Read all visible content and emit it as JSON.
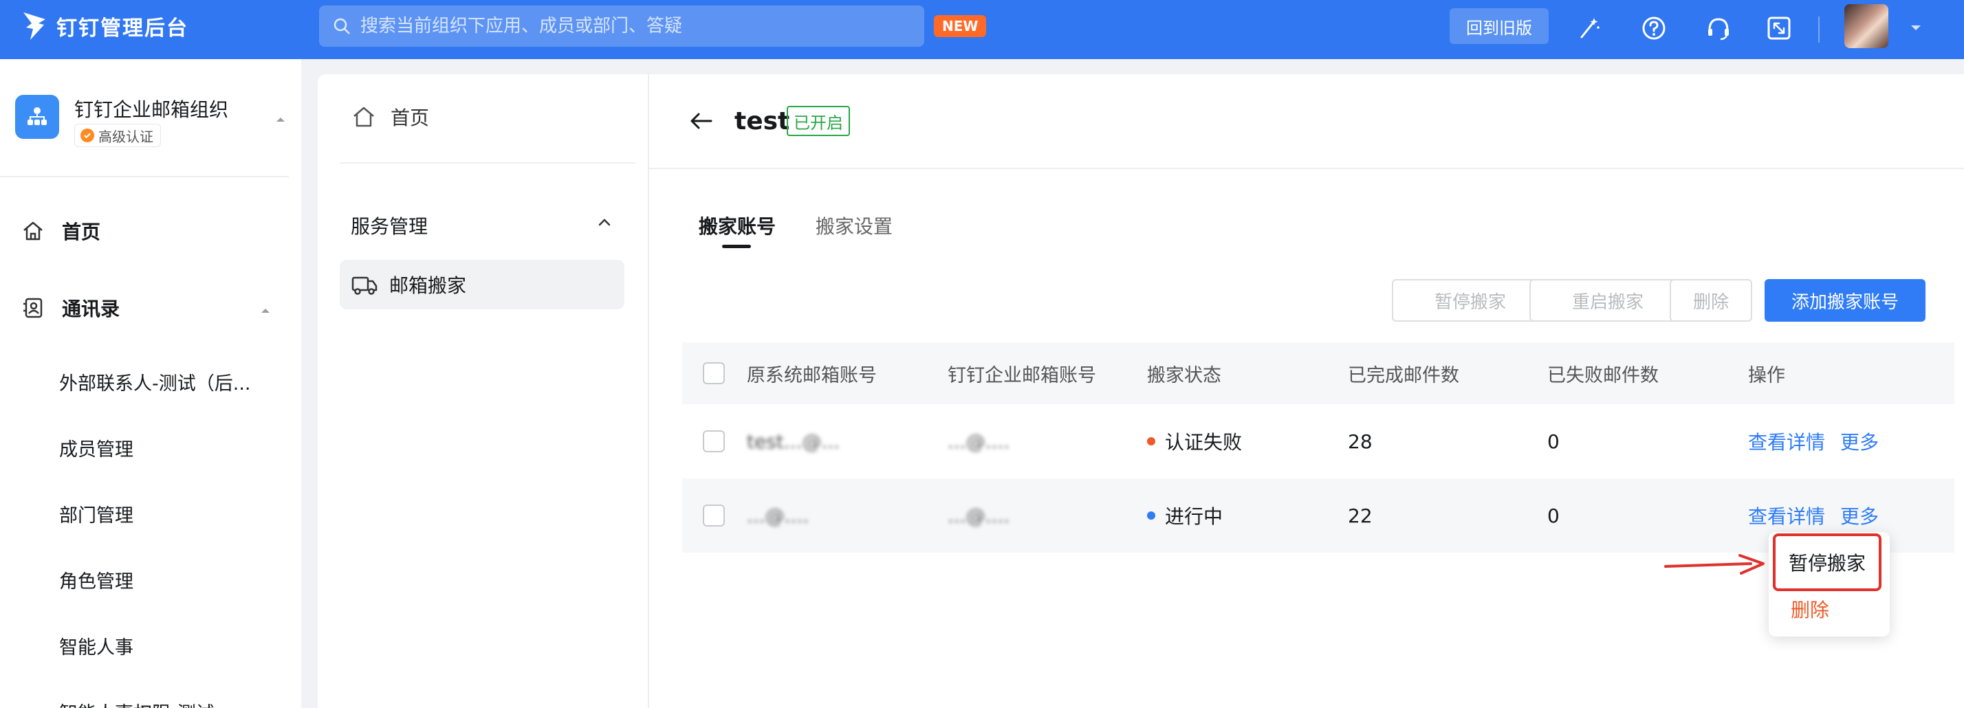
{
  "app": {
    "logo_text": "钉钉管理后台",
    "search_placeholder": "搜索当前组织下应用、成员或部门、答疑",
    "new_badge": "NEW",
    "old_version_label": "回到旧版"
  },
  "sidebar": {
    "org_name": "钉钉企业邮箱组织",
    "org_badge": "高级认证",
    "home_label": "首页",
    "contacts_label": "通讯录",
    "sub_items": [
      "外部联系人-测试（后...",
      "成员管理",
      "部门管理",
      "角色管理",
      "智能人事",
      "智能人事权限-测试"
    ]
  },
  "panel": {
    "home_label": "首页",
    "section_title": "服务管理",
    "active_item": "邮箱搬家"
  },
  "main": {
    "title": "test",
    "status_badge": "已开启",
    "tabs": [
      "搬家账号",
      "搬家设置"
    ],
    "buttons": {
      "pause": "暂停搬家",
      "restart": "重启搬家",
      "delete": "删除",
      "add": "添加搬家账号"
    },
    "table": {
      "headers": [
        "原系统邮箱账号",
        "钉钉企业邮箱账号",
        "搬家状态",
        "已完成邮件数",
        "已失败邮件数",
        "操作"
      ],
      "rows": [
        {
          "source": "test...@...",
          "target": "...@....",
          "status": "认证失败",
          "status_color": "#f05a28",
          "completed": "28",
          "failed": "0",
          "detail": "查看详情",
          "more": "更多"
        },
        {
          "source": "...@....",
          "target": "...@....",
          "status": "进行中",
          "status_color": "#2f7cf6",
          "completed": "22",
          "failed": "0",
          "detail": "查看详情",
          "more": "更多"
        }
      ]
    },
    "dropdown": {
      "pause": "暂停搬家",
      "delete": "删除"
    }
  },
  "colors": {
    "brand": "#3077f1",
    "primary": "#2f7cf6",
    "success": "#28a745",
    "danger": "#f05a28",
    "highlight": "#e0312b"
  }
}
